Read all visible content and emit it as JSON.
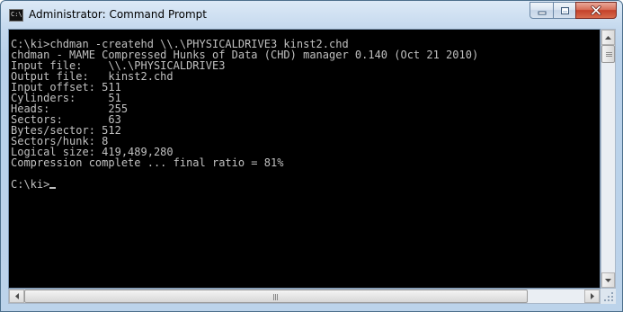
{
  "window": {
    "title": "Administrator: Command Prompt",
    "icon": "command-prompt-icon",
    "icon_glyph": "C:\\"
  },
  "controls": {
    "minimize": "minimize-icon",
    "maximize": "maximize-icon",
    "close": "close-icon"
  },
  "console": {
    "lines": [
      "C:\\ki>chdman -createhd \\\\.\\PHYSICALDRIVE3 kinst2.chd",
      "chdman - MAME Compressed Hunks of Data (CHD) manager 0.140 (Oct 21 2010)",
      "Input file:    \\\\.\\PHYSICALDRIVE3",
      "Output file:   kinst2.chd",
      "Input offset: 511",
      "Cylinders:     51",
      "Heads:         255",
      "Sectors:       63",
      "Bytes/sector: 512",
      "Sectors/hunk: 8",
      "Logical size: 419,489,280",
      "Compression complete ... final ratio = 81%"
    ],
    "prompt": "C:\\ki>"
  },
  "colors": {
    "console_bg": "#000000",
    "console_fg": "#c0c0c0",
    "close_button": "#c4412a",
    "frame": "#b9d1ea"
  },
  "scrollbars": {
    "vertical_position": 0,
    "horizontal_position": 0
  }
}
